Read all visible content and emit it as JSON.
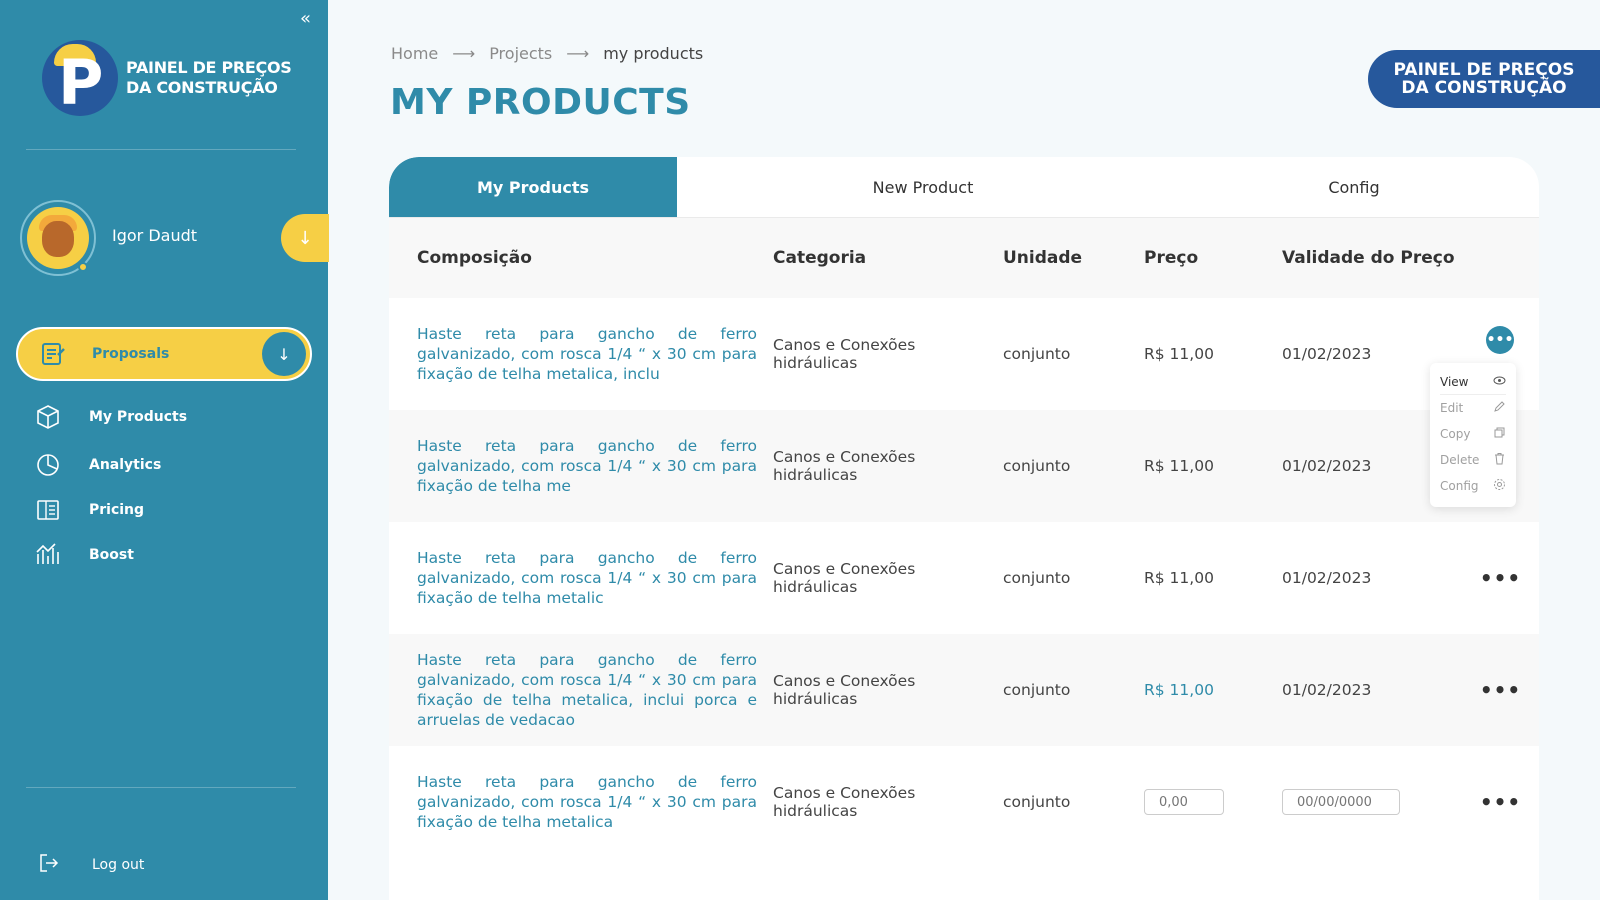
{
  "brand": {
    "line1": "PAINEL DE PREÇOS",
    "line2": "DA CONSTRUÇÃO"
  },
  "sidebar": {
    "collapse_icon": "«",
    "user_name": "Igor Daudt",
    "user_toggle_icon": "↓",
    "active_item": {
      "label": "Proposals",
      "icon": "clipboard-icon",
      "toggle": "↓"
    },
    "items": [
      {
        "label": "My Products",
        "icon": "box-icon"
      },
      {
        "label": "Analytics",
        "icon": "pie-chart-icon"
      },
      {
        "label": "Pricing",
        "icon": "price-list-icon"
      },
      {
        "label": "Boost",
        "icon": "growth-icon"
      }
    ],
    "logout_label": "Log out"
  },
  "breadcrumb": {
    "home": "Home",
    "projects": "Projects",
    "current": "my products",
    "separator": "⟶"
  },
  "page_title": "MY PRODUCTS",
  "tabs": [
    {
      "label": "My Products",
      "active": true
    },
    {
      "label": "New Product",
      "active": false
    },
    {
      "label": "Config",
      "active": false
    }
  ],
  "table": {
    "headers": [
      "Composição",
      "Categoria",
      "Unidade",
      "Preço",
      "Validade do Preço"
    ],
    "rows": [
      {
        "desc": "Haste reta para gancho de ferro galvanizado, com rosca 1/4 “ x 30 cm para fixação de telha metalica, inclu",
        "categoria": "Canos e Conexões hidráulicas",
        "unidade": "conjunto",
        "preco": "R$ 11,00",
        "validade": "01/02/2023"
      },
      {
        "desc": "Haste reta para gancho de ferro galvanizado, com rosca 1/4 “ x 30 cm para fixação de telha me",
        "categoria": "Canos e Conexões hidráulicas",
        "unidade": "conjunto",
        "preco": "R$ 11,00",
        "validade": "01/02/2023"
      },
      {
        "desc": "Haste reta para gancho de ferro galvanizado, com rosca 1/4 “ x 30 cm para fixação de telha metalic",
        "categoria": "Canos e Conexões hidráulicas",
        "unidade": "conjunto",
        "preco": "R$ 11,00",
        "validade": "01/02/2023"
      },
      {
        "desc": "Haste reta para gancho de ferro galvanizado, com rosca 1/4 “ x 30 cm para fixação de telha metalica, inclui porca e arruelas de vedacao",
        "categoria": "Canos e Conexões hidráulicas",
        "unidade": "conjunto",
        "preco": "R$ 11,00",
        "validade": "01/02/2023"
      },
      {
        "desc": "Haste reta para gancho de ferro galvanizado, com rosca 1/4 “ x 30 cm para fixação de telha metalica",
        "categoria": "Canos e Conexões hidráulicas",
        "unidade": "conjunto",
        "preco_placeholder": "0,00",
        "validade_placeholder": "00/00/0000"
      }
    ],
    "actions_icon": "•••"
  },
  "context_menu": [
    {
      "label": "View",
      "icon": "eye-icon"
    },
    {
      "label": "Edit",
      "icon": "pencil-icon"
    },
    {
      "label": "Copy",
      "icon": "copy-icon"
    },
    {
      "label": "Delete",
      "icon": "trash-icon"
    },
    {
      "label": "Config",
      "icon": "gear-icon"
    }
  ],
  "colors": {
    "primary": "#2f8ba9",
    "accent": "#f6cf45",
    "brand_dark": "#26589c"
  }
}
